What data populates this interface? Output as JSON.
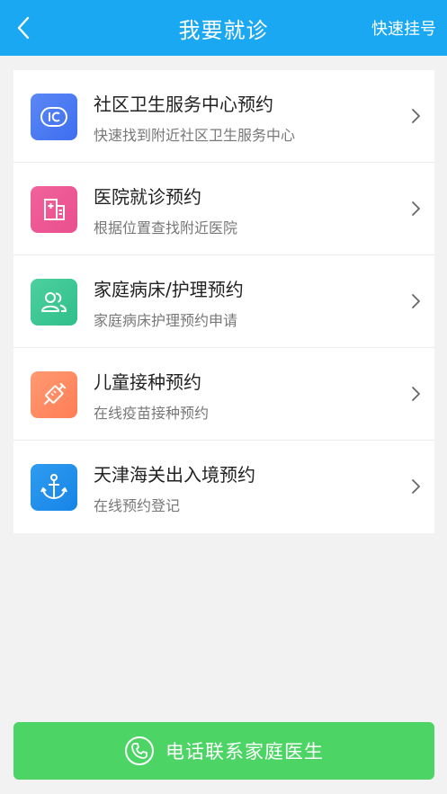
{
  "header": {
    "title": "我要就诊",
    "action_label": "快速挂号",
    "background": "#1ba8f2"
  },
  "items": [
    {
      "title": "社区卫生服务中心预约",
      "subtitle": "快速找到附近社区卫生服务中心",
      "icon": "community-health-center-icon",
      "color_from": "#5b88f5",
      "color_to": "#3e6ef0"
    },
    {
      "title": "医院就诊预约",
      "subtitle": "根据位置查找附近医院",
      "icon": "hospital-building-icon",
      "color_from": "#f0629b",
      "color_to": "#ea4f8e"
    },
    {
      "title": "家庭病床/护理预约",
      "subtitle": "家庭病床护理预约申请",
      "icon": "people-icon",
      "color_from": "#4dd0a0",
      "color_to": "#2fbf8a"
    },
    {
      "title": "儿童接种预约",
      "subtitle": "在线疫苗接种预约",
      "icon": "syringe-icon",
      "color_from": "#ff9a72",
      "color_to": "#ff7d55"
    },
    {
      "title": "天津海关出入境预约",
      "subtitle": "在线预约登记",
      "icon": "anchor-icon",
      "color_from": "#2f9cf0",
      "color_to": "#1684e6"
    }
  ],
  "call_button": {
    "label": "电话联系家庭医生",
    "icon": "phone-icon",
    "background": "#4cd464"
  }
}
